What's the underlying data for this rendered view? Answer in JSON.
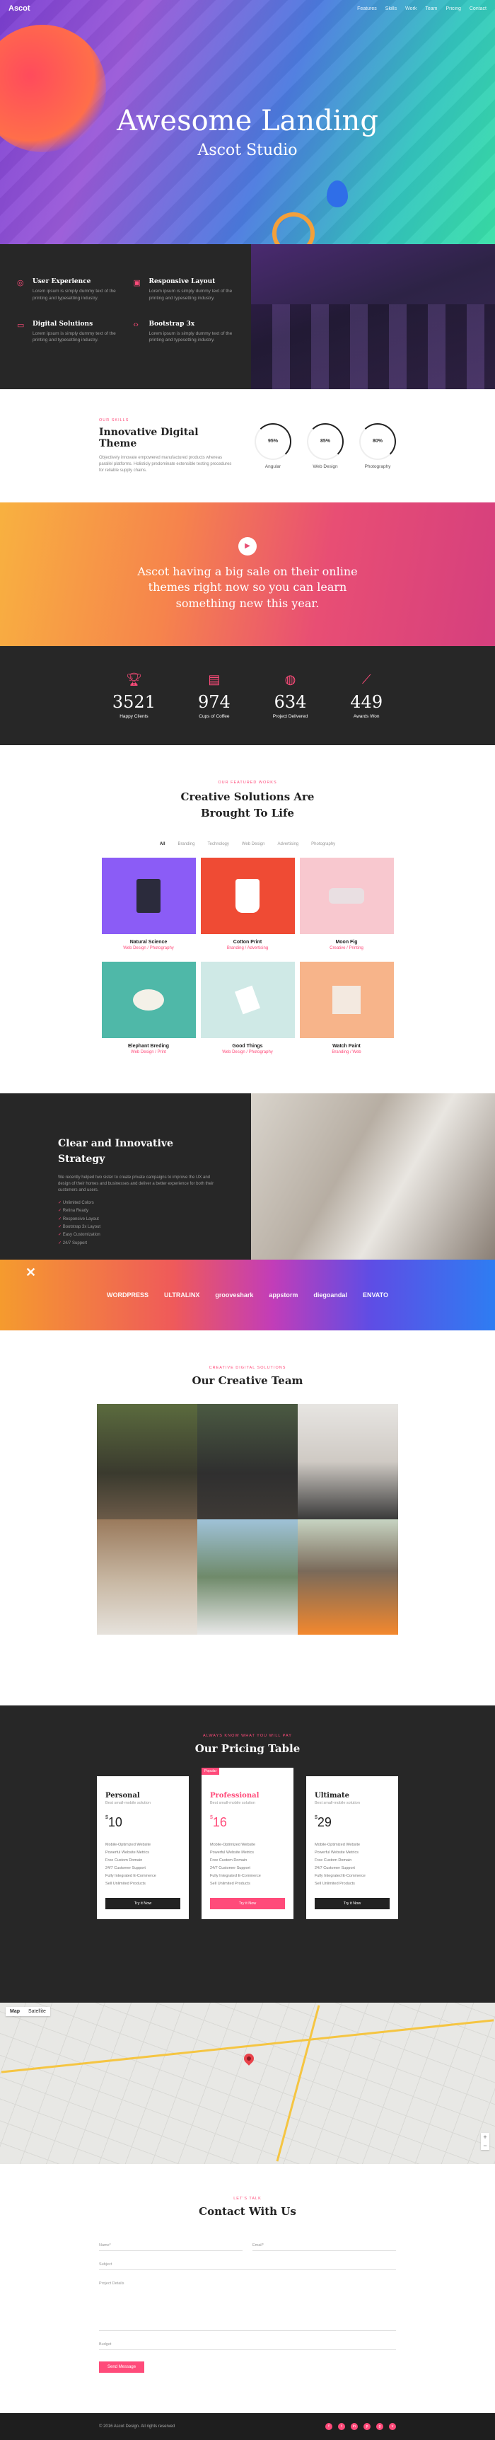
{
  "nav": {
    "logo": "Ascot",
    "items": [
      "Features",
      "Skills",
      "Work",
      "Team",
      "Pricing",
      "Contact"
    ]
  },
  "hero": {
    "title": "Awesome Landing",
    "subtitle": "Ascot Studio"
  },
  "features": [
    {
      "icon": "target-icon",
      "title": "User Experience",
      "text": "Lorem ipsum is simply dummy text of the printing and typesetting industry."
    },
    {
      "icon": "layout-icon",
      "title": "Responsive Layout",
      "text": "Lorem ipsum is simply dummy text of the printing and typesetting industry."
    },
    {
      "icon": "screen-icon",
      "title": "Digital Solutions",
      "text": "Lorem ipsum is simply dummy text of the printing and typesetting industry."
    },
    {
      "icon": "code-icon",
      "title": "Bootstrap 3x",
      "text": "Lorem ipsum is simply dummy text of the printing and typesetting industry."
    }
  ],
  "skills": {
    "tag": "Our Skills",
    "title": "Innovative Digital Theme",
    "text": "Objectively innovate empowered manufactured products whereas parallel platforms. Holisticly predominate extensible testing procedures for reliable supply chains.",
    "circles": [
      {
        "value": "95%",
        "label": "Angular"
      },
      {
        "value": "85%",
        "label": "Web Design"
      },
      {
        "value": "80%",
        "label": "Photography"
      }
    ]
  },
  "promo": {
    "text": "Ascot having a big sale on their online themes right now so you can learn something new this year."
  },
  "stats": [
    {
      "icon": "trophy-icon",
      "value": "3521",
      "label": "Happy Clients"
    },
    {
      "icon": "briefcase-icon",
      "value": "974",
      "label": "Cups of Coffee"
    },
    {
      "icon": "globe-icon",
      "value": "634",
      "label": "Project Delivered"
    },
    {
      "icon": "chart-line-icon",
      "value": "449",
      "label": "Awards Won"
    }
  ],
  "portfolio": {
    "tag": "Our Featured Works",
    "title_line1": "Creative Solutions Are",
    "title_line2": "Brought To Life",
    "filters": [
      "All",
      "Branding",
      "Technology",
      "Web Design",
      "Advertising",
      "Photography"
    ],
    "items": [
      {
        "title": "Natural Science",
        "cat": "Web Design / Photography",
        "color": "#8b5cf6"
      },
      {
        "title": "Cotton Print",
        "cat": "Branding / Advertising",
        "color": "#ef4b34"
      },
      {
        "title": "Moon Fig",
        "cat": "Creative / Printing",
        "color": "#f8c8cf"
      },
      {
        "title": "Elephant Breding",
        "cat": "Web Design / Print",
        "color": "#4fb8a8"
      },
      {
        "title": "Good Things",
        "cat": "Web Design / Photography",
        "color": "#cfe9e6"
      },
      {
        "title": "Watch Paint",
        "cat": "Branding / Web",
        "color": "#f7b48a"
      }
    ]
  },
  "clear": {
    "title_line1": "Clear and Innovative",
    "title_line2": "Strategy",
    "text": "We recently helped two sister to create private campaigns to improve the UX and design of their homes and businesses and deliver a better experience for both their customers and users.",
    "list": [
      "Unlimited Colors",
      "Retina Ready",
      "Responsive Layout",
      "Bootstrap 3x Layout",
      "Easy Customization",
      "24/7 Support"
    ]
  },
  "brands": [
    "WORDPRESS",
    "ULTRALINX",
    "grooveshark",
    "appstorm",
    "diegoandal",
    "ENVATO"
  ],
  "team": {
    "tag": "Creative Digital Solutions",
    "title": "Our Creative Team"
  },
  "pricing": {
    "tag": "Always Know What You Will Pay",
    "title": "Our Pricing Table",
    "plans": [
      {
        "name": "Personal",
        "sub": "Best small-mobile solution",
        "price": "10",
        "features": [
          "Mobile-Optimized Website",
          "Powerful Website Metrics",
          "Free Custom Domain",
          "24/7 Customer Support",
          "Fully Integrated E-Commerce",
          "Sell Unlimited Products"
        ],
        "button": "Try it Now"
      },
      {
        "name": "Professional",
        "badge": "Popular",
        "sub": "Best small-mobile solution",
        "price": "16",
        "features": [
          "Mobile-Optimized Website",
          "Powerful Website Metrics",
          "Free Custom Domain",
          "24/7 Customer Support",
          "Fully Integrated E-Commerce",
          "Sell Unlimited Products"
        ],
        "button": "Try it Now"
      },
      {
        "name": "Ultimate",
        "sub": "Best small-mobile solution",
        "price": "29",
        "features": [
          "Mobile-Optimized Website",
          "Powerful Website Metrics",
          "Free Custom Domain",
          "24/7 Customer Support",
          "Fully Integrated E-Commerce",
          "Sell Unlimited Products"
        ],
        "button": "Try it Now"
      }
    ],
    "currency": "$"
  },
  "map": {
    "tabs": [
      "Map",
      "Satellite"
    ]
  },
  "contact": {
    "tag": "Let's Talk",
    "title": "Contact With Us",
    "fields": {
      "name": "Name*",
      "email": "Email*",
      "subject": "Subject",
      "message": "Project Details",
      "budget": "Budget"
    },
    "button": "Send Message"
  },
  "footer": {
    "copyright": "© 2016 Ascot Design. All rights reserved",
    "social": [
      "f",
      "t",
      "in",
      "p",
      "g",
      "v"
    ]
  }
}
